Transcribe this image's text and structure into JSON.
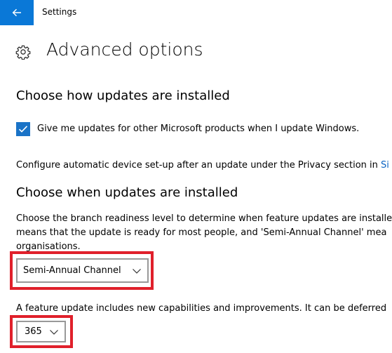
{
  "window": {
    "title": "Settings"
  },
  "header": {
    "title": "Advanced options",
    "icon": "gear-icon"
  },
  "section_install": {
    "heading": "Choose how updates are installed",
    "checkbox_label": "Give me updates for other Microsoft products when I update Windows.",
    "checkbox_checked": true,
    "privacy_text": "Configure automatic device set-up after an update under the Privacy section in ",
    "privacy_link": "Si"
  },
  "section_when": {
    "heading": "Choose when updates are installed",
    "description_line1": "Choose the branch readiness level to determine when feature updates are installe",
    "description_line2": "means that the update is ready for most people, and 'Semi-Annual Channel' mea",
    "description_line3": "organisations.",
    "branch_select_value": "Semi-Annual Channel",
    "feature_text": "A feature update includes new capabilities and improvements. It can be deferred",
    "defer_select_value": "365"
  },
  "colors": {
    "accent": "#0a78d7",
    "checkbox": "#1a73c7",
    "highlight": "#e0202b",
    "link": "#0a63c2"
  }
}
